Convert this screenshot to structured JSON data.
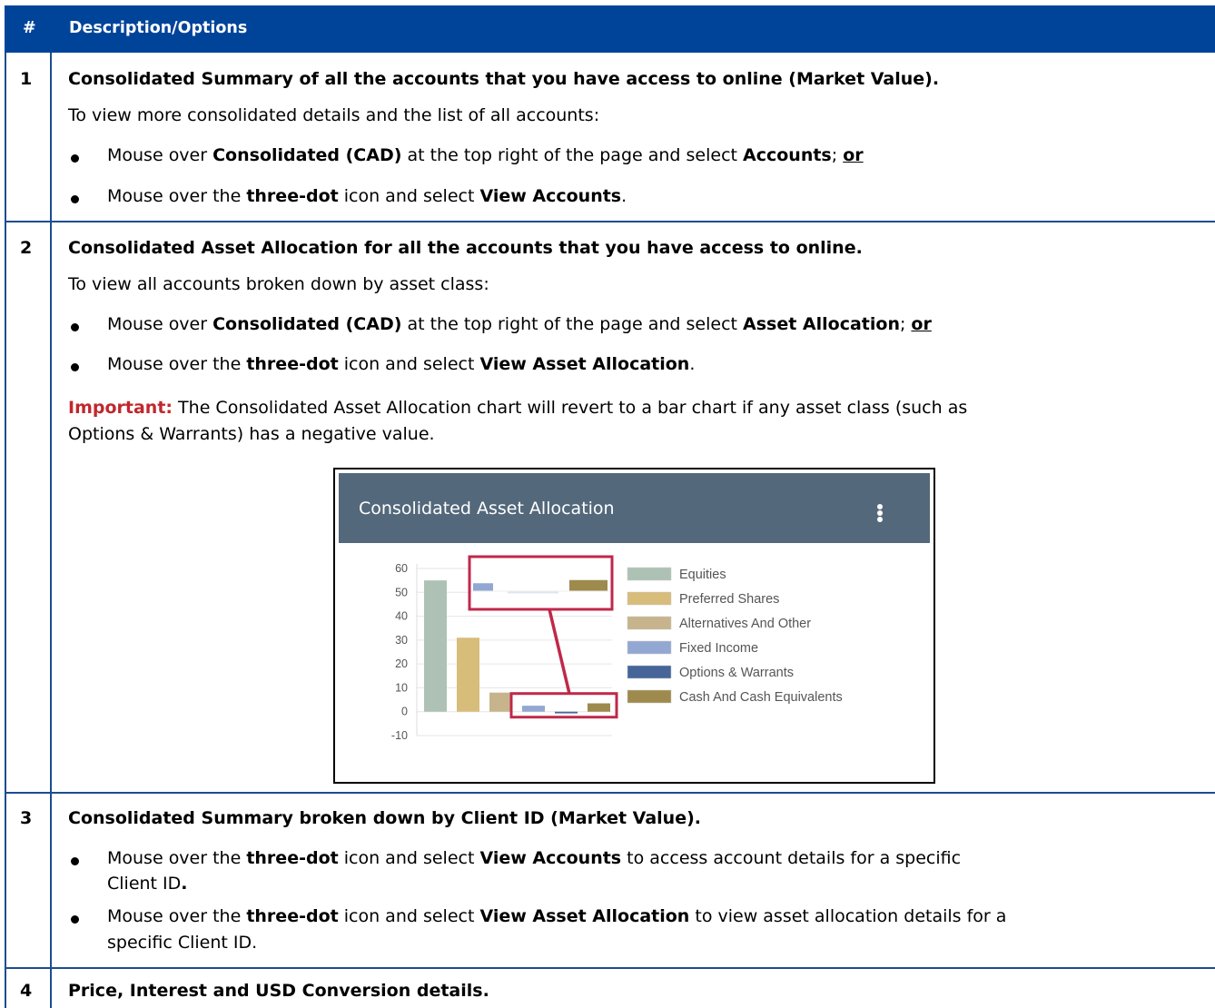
{
  "header": {
    "num": "#",
    "title": "Description/Options"
  },
  "row1": {
    "num": "1",
    "title": "Consolidated Summary of all the accounts that you have access to online (Market Value).",
    "intro": "To view more consolidated details and the list of all accounts:",
    "b1": {
      "a": "Mouse over ",
      "b": "Consolidated (CAD)",
      "c": " at the top right of the page and select ",
      "d": "Accounts",
      "e": "; ",
      "f": "or"
    },
    "b2": {
      "a": "Mouse over the ",
      "b": "three-dot",
      "c": " icon and select ",
      "d": "View Accounts",
      "e": "."
    }
  },
  "row2": {
    "num": "2",
    "title": "Consolidated Asset Allocation for all the accounts that you have access to online.",
    "intro": "To view all accounts broken down by asset class:",
    "b1": {
      "a": "Mouse over ",
      "b": "Consolidated (CAD)",
      "c": " at the top right of the page and select ",
      "d": "Asset Allocation",
      "e": "; ",
      "f": "or"
    },
    "b2": {
      "a": "Mouse over the ",
      "b": "three-dot",
      "c": " icon and select ",
      "d": "View Asset Allocation",
      "e": "."
    },
    "important_label": "Important:",
    "important_line1": " The Consolidated Asset Allocation chart will revert to a bar chart if any asset class (such as",
    "important_line2": "Options & Warrants) has a negative value."
  },
  "widget": {
    "title": "Consolidated Asset Allocation",
    "menu_icon": "three-dot-vertical-icon"
  },
  "chart_data": {
    "type": "bar",
    "categories": [
      "Equities",
      "Preferred Shares",
      "Alternatives And Other",
      "Fixed Income",
      "Options & Warrants",
      "Cash And Cash Equivalents"
    ],
    "values": [
      55,
      31,
      8,
      2.5,
      -0.7,
      3.5
    ],
    "colors": [
      "#adc2b5",
      "#d8bc7a",
      "#c7b48c",
      "#92a8d2",
      "#46669a",
      "#9d8a4c"
    ],
    "ylim": [
      -10,
      60
    ],
    "yticks": [
      "60",
      "50",
      "40",
      "30",
      "20",
      "10",
      "0",
      "-10"
    ],
    "legend_position": "right",
    "highlight_color": "#c0284a"
  },
  "row3": {
    "num": "3",
    "title": "Consolidated Summary broken down by Client ID (Market Value).",
    "b1": {
      "a": "Mouse over the ",
      "b": "three-dot",
      "c": " icon and select ",
      "d": "View Accounts",
      "e": " to access account details for a specific",
      "l2a": "Client ID",
      "l2b": "."
    },
    "b2": {
      "a": "Mouse over the ",
      "b": "three-dot",
      "c": " icon and select ",
      "d": "View Asset Allocation",
      "e": " to view asset allocation details for a",
      "l2a": "specific Client ID."
    }
  },
  "row4": {
    "num": "4",
    "title": "Price, Interest and USD Conversion details."
  }
}
